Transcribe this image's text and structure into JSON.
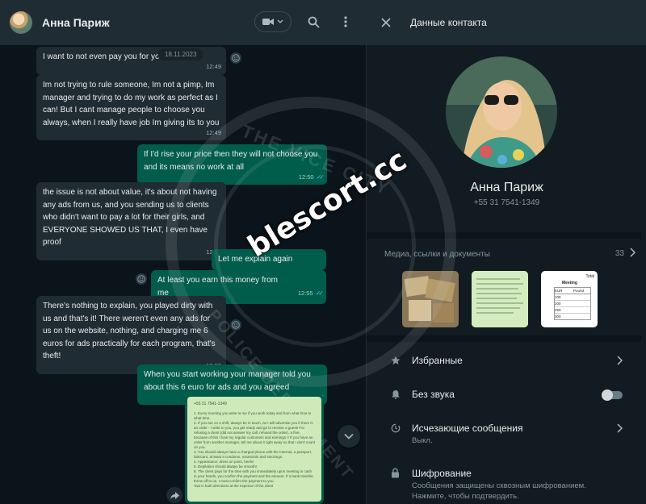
{
  "chat": {
    "contact_name": "Анна Париж",
    "date_chip": "18.11.2023",
    "messages": [
      {
        "dir": "in",
        "text": "I want to not even pay you for your character",
        "time": "12:49"
      },
      {
        "dir": "in",
        "text": "Im not trying to rule someone, Im not a pimp, Im manager and trying to do my work as perfect as I can! But I cant manage people to choose you always, when I really have job Im giving its to you",
        "time": "12:49"
      },
      {
        "dir": "out",
        "text": "If I'd  rise your price then they will not choose you and its means no work at all",
        "time": "12:50"
      },
      {
        "dir": "in",
        "text": "the issue is not about value, it's about not having any ads from us, and you sending us to clients who didn't want to pay a lot for their girls, and EVERYONE SHOWED US THAT, I even have proof",
        "time": "12:51"
      },
      {
        "dir": "out",
        "text": "Let me explain again",
        "time": ""
      },
      {
        "dir": "out",
        "text": "At least you earn this money from me",
        "time": "12:55"
      },
      {
        "dir": "in",
        "text": "There's nothing to explain, you played dirty with us and that's it! There weren't even any ads for us on the website, nothing, and charging me 6 euros for ads practically for each program, that's theft!",
        "time": "12:55"
      },
      {
        "dir": "out",
        "text": "When you start working your manager told you about this 6 euro for ads and you agreed",
        "time": "12:57"
      }
    ],
    "document_lines": [
      "+55 31 7541-1349",
      "1. Every morning you write to me if you work today and from what time to what time.",
      "2. If you are on a shift, always be in touch, as I will advertise you if there is an order - I write to you, you get ready and go to receive a guest! For refusing a client (did not answer my call, refused the order), a fine, because of this I lose my regular customers and earnings !! If you have an order from another manager, tell me about it right away so that I don't count on you.",
      "3. You should always have a charged phone with the Internet, a passport, lubricant, at least 3 condoms, miramistin and stockings.",
      "4. Appearance: dress on point, heels!",
      "5. Depilation should always be smooth!",
      "6. The client pays for the time with you immediately upon meeting in cash in your hands, you confirm the payment and the amount. If a bank transfer, throw off to us. I must confirm the payment to you.",
      "Taxi in both directions at the expense of the client"
    ]
  },
  "contact": {
    "header_title": "Данные контакта",
    "name": "Анна Париж",
    "phone": "+55 31 7541-1349",
    "media_label": "Медиа, ссылки и документы",
    "media_count": "33",
    "starred": "Избранные",
    "mute": "Без звука",
    "disappearing": "Исчезающие сообщения",
    "disappearing_sub": "Выкл.",
    "encryption": "Шифрование",
    "encryption_sub": "Сообщения защищены сквозным шифрованием. Нажмите, чтобы подтвердить.",
    "thumb3_header": "Total",
    "thumb3_title": "Meeting",
    "thumb3_cols": [
      "EUR",
      "Pound"
    ],
    "thumb3_values": [
      "100",
      "200",
      "250",
      "300"
    ]
  },
  "watermark": {
    "site": "blescort.cc",
    "seal_top": "THE VICE CITY",
    "seal_bottom": "POLICE DEPARTMENT"
  },
  "colors": {
    "incoming_bubble": "#202c33",
    "outgoing_bubble": "#005c4b",
    "background": "#0b141a",
    "panel": "#111b21",
    "header": "#202c33"
  }
}
